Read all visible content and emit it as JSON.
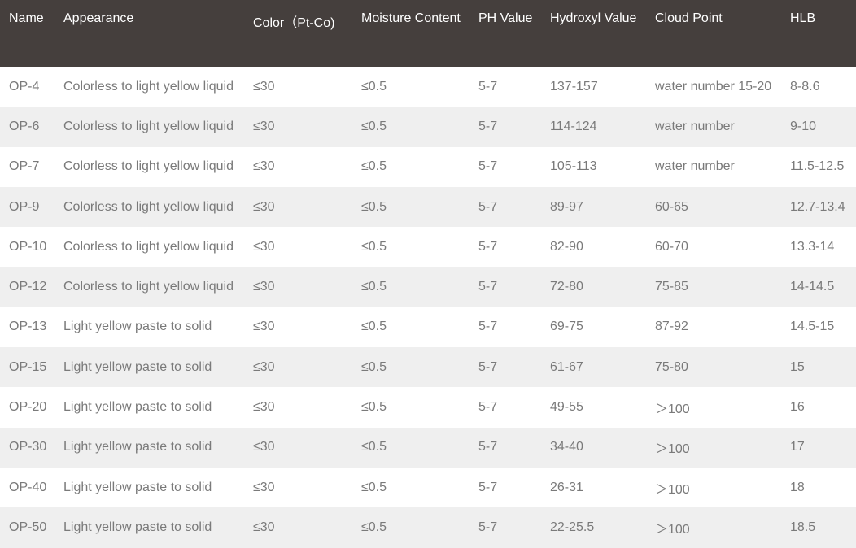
{
  "table": {
    "headers": [
      "Name",
      "Appearance",
      "Color（Pt-Co)",
      "Moisture Content",
      "PH Value",
      "Hydroxyl Value",
      "Cloud Point",
      "HLB"
    ],
    "rows": [
      [
        "OP-4",
        "Colorless to light yellow liquid",
        "≤30",
        "≤0.5",
        "5-7",
        "137-157",
        "water number 15-20",
        "8-8.6"
      ],
      [
        "OP-6",
        "Colorless to light yellow liquid",
        "≤30",
        "≤0.5",
        "5-7",
        "114-124",
        "water number",
        "9-10"
      ],
      [
        "OP-7",
        "Colorless to light yellow liquid",
        "≤30",
        "≤0.5",
        "5-7",
        "105-113",
        "water number",
        "11.5-12.5"
      ],
      [
        "OP-9",
        "Colorless to light yellow liquid",
        "≤30",
        "≤0.5",
        "5-7",
        "89-97",
        "60-65",
        "12.7-13.4"
      ],
      [
        "OP-10",
        "Colorless to light yellow liquid",
        "≤30",
        "≤0.5",
        "5-7",
        "82-90",
        "60-70",
        "13.3-14"
      ],
      [
        "OP-12",
        "Colorless to light yellow liquid",
        "≤30",
        "≤0.5",
        "5-7",
        "72-80",
        "75-85",
        "14-14.5"
      ],
      [
        "OP-13",
        "Light yellow paste to solid",
        "≤30",
        "≤0.5",
        "5-7",
        "69-75",
        "87-92",
        "14.5-15"
      ],
      [
        "OP-15",
        "Light yellow paste to solid",
        "≤30",
        "≤0.5",
        "5-7",
        "61-67",
        "75-80",
        "15"
      ],
      [
        "OP-20",
        "Light yellow paste to solid",
        "≤30",
        "≤0.5",
        "5-7",
        "49-55",
        "＞100",
        "16"
      ],
      [
        "OP-30",
        "Light yellow paste to solid",
        "≤30",
        "≤0.5",
        "5-7",
        "34-40",
        "＞100",
        "17"
      ],
      [
        "OP-40",
        "Light yellow paste to solid",
        "≤30",
        "≤0.5",
        "5-7",
        "26-31",
        "＞100",
        "18"
      ],
      [
        "OP-50",
        "Light yellow paste to solid",
        "≤30",
        "≤0.5",
        "5-7",
        "22-25.5",
        "＞100",
        "18.5"
      ]
    ]
  }
}
